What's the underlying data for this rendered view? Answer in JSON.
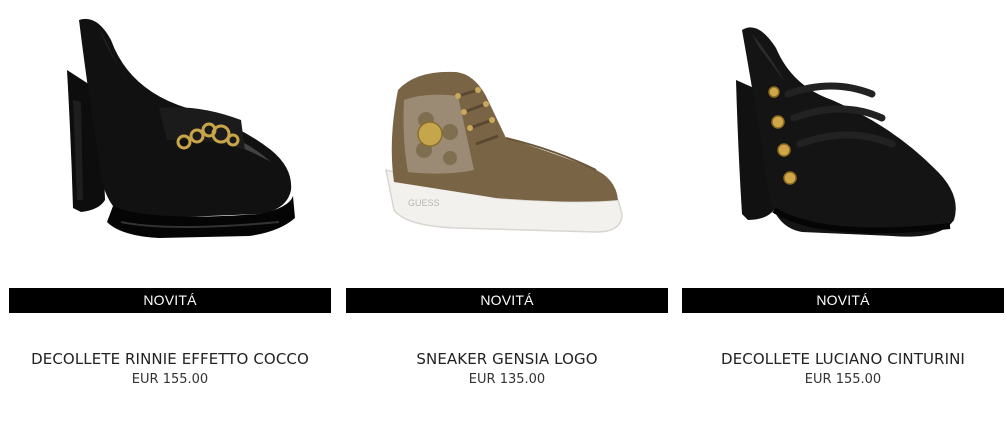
{
  "products": [
    {
      "badge": "NOVITÁ",
      "name": "DECOLLETE RINNIE EFFETTO COCCO",
      "price": "EUR 155.00"
    },
    {
      "badge": "NOVITÁ",
      "name": "SNEAKER GENSIA LOGO",
      "price": "EUR 135.00",
      "image_text": "GUESS"
    },
    {
      "badge": "NOVITÁ",
      "name": "DECOLLETE LUCIANO CINTURINI",
      "price": "EUR 155.00"
    }
  ]
}
